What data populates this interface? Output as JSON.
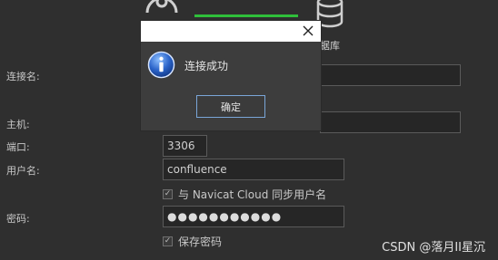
{
  "background": {
    "db_caption_fragment": "据库"
  },
  "form": {
    "connection_name_label": "连接名:",
    "host_label": "主机:",
    "port_label": "端口:",
    "port_value": "3306",
    "username_label": "用户名:",
    "username_value": "confluence",
    "sync_username_label": "与 Navicat Cloud 同步用户名",
    "sync_username_checked": true,
    "password_label": "密码:",
    "password_masked": "●●●●●●●●●●●",
    "save_password_label": "保存密码",
    "save_password_checked": true
  },
  "dialog": {
    "message": "连接成功",
    "ok_label": "确定"
  },
  "icons": {
    "dialog_icon": "info-icon",
    "close": "close-icon",
    "database": "database-icon",
    "connection": "connection-icon"
  },
  "colors": {
    "progress": "#2fbf3a",
    "button_border": "#7aa6d8",
    "background": "#2f2f2f"
  },
  "watermark": "CSDN @落月II星沉"
}
